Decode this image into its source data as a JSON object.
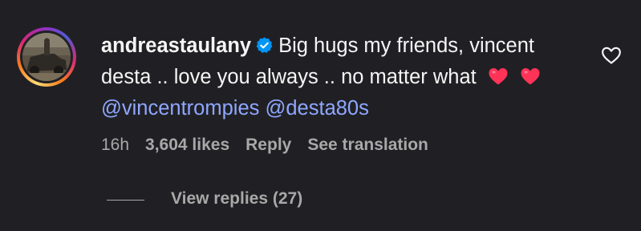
{
  "comment": {
    "username": "andreastaulany",
    "text_line1": "Big hugs my friends, vincent",
    "text_line2": "desta .. love you always .. no matter what",
    "mentions": [
      "@vincentrompies",
      "@desta80s"
    ],
    "emojis": [
      "heart-emoji",
      "heart-emoji"
    ]
  },
  "meta": {
    "time": "16h",
    "likes": "3,604 likes",
    "reply": "Reply",
    "see_translation": "See translation"
  },
  "replies": {
    "label": "View replies (27)"
  },
  "colors": {
    "background": "#202024",
    "text": "#f5f5f5",
    "secondary": "#a8a8a8",
    "mention": "#8fa7ff",
    "verified": "#0095f6",
    "heart": "#ff3358"
  },
  "icons": {
    "verified": "verified-badge-icon",
    "like": "heart-outline-icon"
  }
}
